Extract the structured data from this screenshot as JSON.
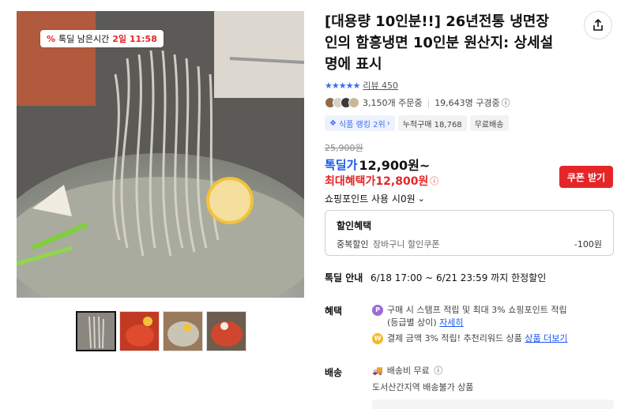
{
  "gallery": {
    "timer_label": "톡딜 남은시간",
    "timer_value": "2일 11:58",
    "thumbnails": [
      "thumb-1",
      "thumb-2",
      "thumb-3",
      "thumb-4"
    ]
  },
  "product": {
    "title": "[대용량 10인분!!] 26년전통 냉면장인의 함흥냉면 10인분 원산지: 상세설명에 표시",
    "rating_stars": "★★★★★",
    "review_label": "리뷰 450",
    "orders": "3,150개 주문중",
    "watchers": "19,643명 구경중",
    "chips": [
      "식품 랭킹 2위",
      "누적구매 18,768",
      "무료배송"
    ],
    "original_price": "25,900원",
    "deal_label": "톡딜가",
    "deal_price": "12,900원~",
    "max_benefit_label": "최대혜택가",
    "max_benefit_price": "12,800원",
    "coupon_button": "쿠폰 받기",
    "point_use": "쇼핑포인트 사용 시0원"
  },
  "discount": {
    "heading": "할인혜택",
    "line_label": "중복할인",
    "line_sub": "장바구니 할인쿠폰",
    "line_value": "-100원"
  },
  "deal_info": {
    "label": "톡딜 안내",
    "value": "6/18 17:00 ~ 6/21 23:59 까지 한정할인"
  },
  "benefits": {
    "label": "혜택",
    "line1": "구매 시 스탬프 적립 및 최대 3% 쇼핑포인트 적립",
    "line1b": "(등급별 상이)",
    "line1_link": "자세히",
    "line2": "결제 금액 3% 적립! 추천리워드 상품",
    "line2_link": "상품 더보기"
  },
  "shipping": {
    "label": "배송",
    "fee": "배송비 무료",
    "note": "도서산간지역 배송불가 상품"
  },
  "colors": {
    "accent": "#1a56f0",
    "sale": "#e52628"
  }
}
